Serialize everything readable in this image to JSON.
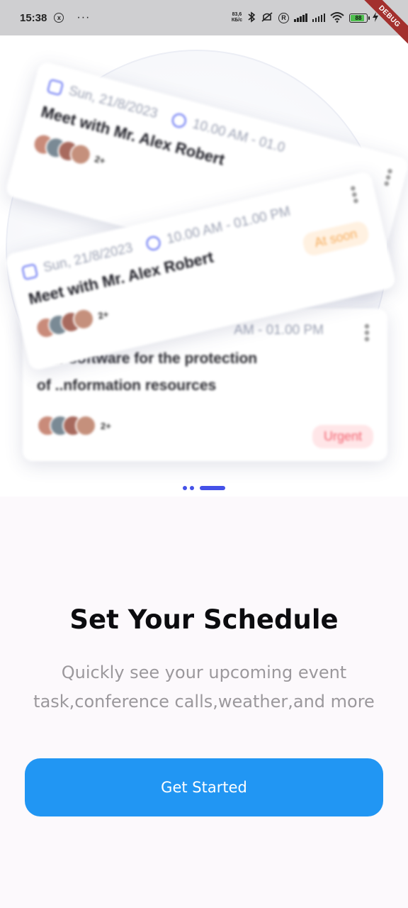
{
  "status_bar": {
    "time": "15:38",
    "notification_glyph": "x",
    "more": "···",
    "net_speed_value": "83,6",
    "net_speed_unit": "КБ/с",
    "icons": [
      "bluetooth-icon",
      "mute-icon",
      "registered-icon",
      "signal-icon",
      "wifi-icon",
      "battery-icon",
      "charging-icon"
    ],
    "registered": "R",
    "battery_level": "88",
    "battery_percent": 88,
    "debug_label": "DEBUG"
  },
  "illustration": {
    "cards": [
      {
        "date": "Sun, 21/8/2023",
        "time": "10.00 AM - 01.0",
        "title": "Meet with Mr. Alex Robert",
        "avatar_count": "2+"
      },
      {
        "date": "Sun, 21/8/2023",
        "time": "10.00 AM - 01.00 PM",
        "title": "Meet with Mr. Alex Robert",
        "badge": "At soon",
        "avatar_count": "2+"
      },
      {
        "time": "AM - 01.00 PM",
        "description_line1": "L            ur software for the protection",
        "description_line2": "of ..nformation resources",
        "badge": "Urgent",
        "avatar_count": "2+"
      }
    ],
    "colors": {
      "accent": "#4451e8",
      "urgent_bg": "#ffe6e8",
      "urgent_text": "#f3606e",
      "soon_bg": "#fff1e1",
      "soon_text": "#f6ae5f"
    }
  },
  "pager": {
    "page_count": 3,
    "active_index": 2
  },
  "onboarding": {
    "title": "Set Your Schedule",
    "subtitle_line1": "Quickly see your upcoming event",
    "subtitle_line2": "task,conference calls,weather,and more",
    "cta_label": "Get Started",
    "cta_color": "#2196f3"
  }
}
